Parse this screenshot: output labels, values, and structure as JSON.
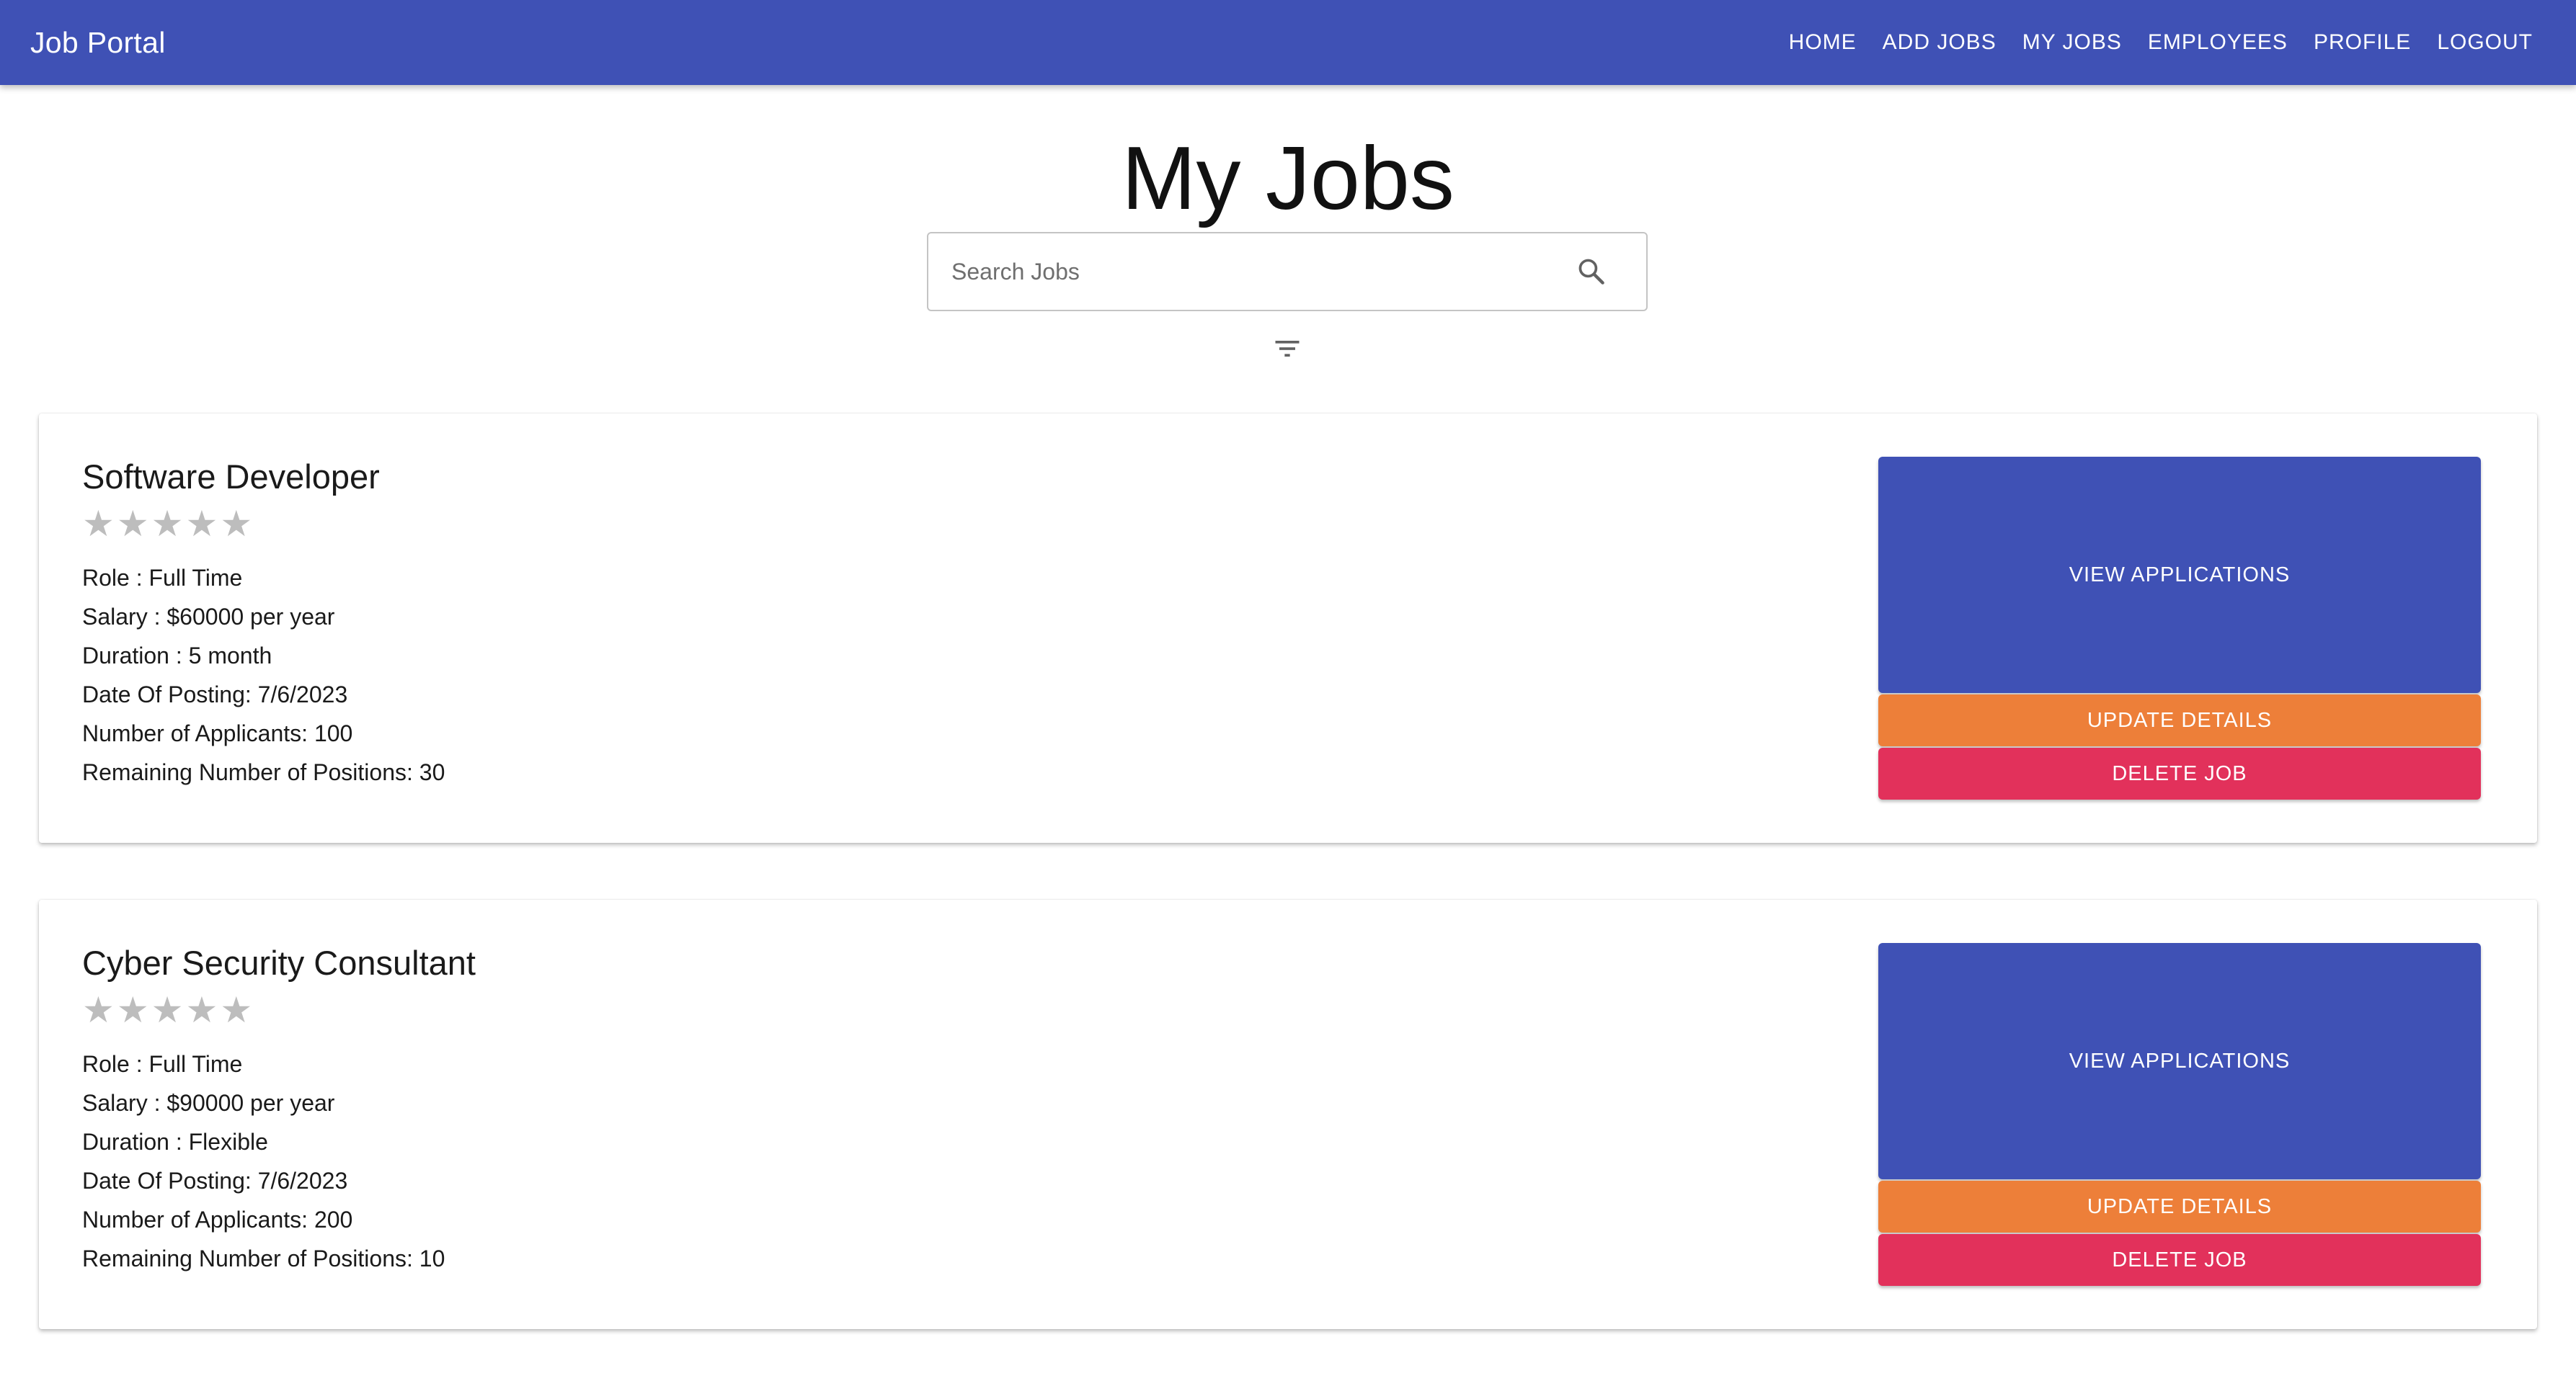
{
  "app": {
    "title": "Job Portal"
  },
  "nav": {
    "items": [
      "HOME",
      "ADD JOBS",
      "MY JOBS",
      "EMPLOYEES",
      "PROFILE",
      "LOGOUT"
    ]
  },
  "page": {
    "title": "My Jobs"
  },
  "search": {
    "placeholder": "Search Jobs",
    "value": "",
    "icon": "search-icon"
  },
  "filter": {
    "icon": "filter-icon"
  },
  "jobs": [
    {
      "title": "Software Developer",
      "rating": 0,
      "rating_max": 5,
      "role": "Role : Full Time",
      "salary": "Salary : $60000 per year",
      "duration": "Duration : 5 month",
      "date_of_posting": "Date Of Posting: 7/6/2023",
      "applicants": "Number of Applicants: 100",
      "remaining_positions": "Remaining Number of Positions: 30",
      "buttons": {
        "view": "VIEW APPLICATIONS",
        "update": "UPDATE DETAILS",
        "delete": "DELETE JOB"
      }
    },
    {
      "title": "Cyber Security Consultant",
      "rating": 0,
      "rating_max": 5,
      "role": "Role : Full Time",
      "salary": "Salary : $90000 per year",
      "duration": "Duration : Flexible",
      "date_of_posting": "Date Of Posting: 7/6/2023",
      "applicants": "Number of Applicants: 200",
      "remaining_positions": "Remaining Number of Positions: 10",
      "buttons": {
        "view": "VIEW APPLICATIONS",
        "update": "UPDATE DETAILS",
        "delete": "DELETE JOB"
      }
    }
  ],
  "colors": {
    "primary": "#3f51b5",
    "update": "#ed7f39",
    "delete": "#e2315b",
    "star_empty": "#bdbdbd"
  }
}
